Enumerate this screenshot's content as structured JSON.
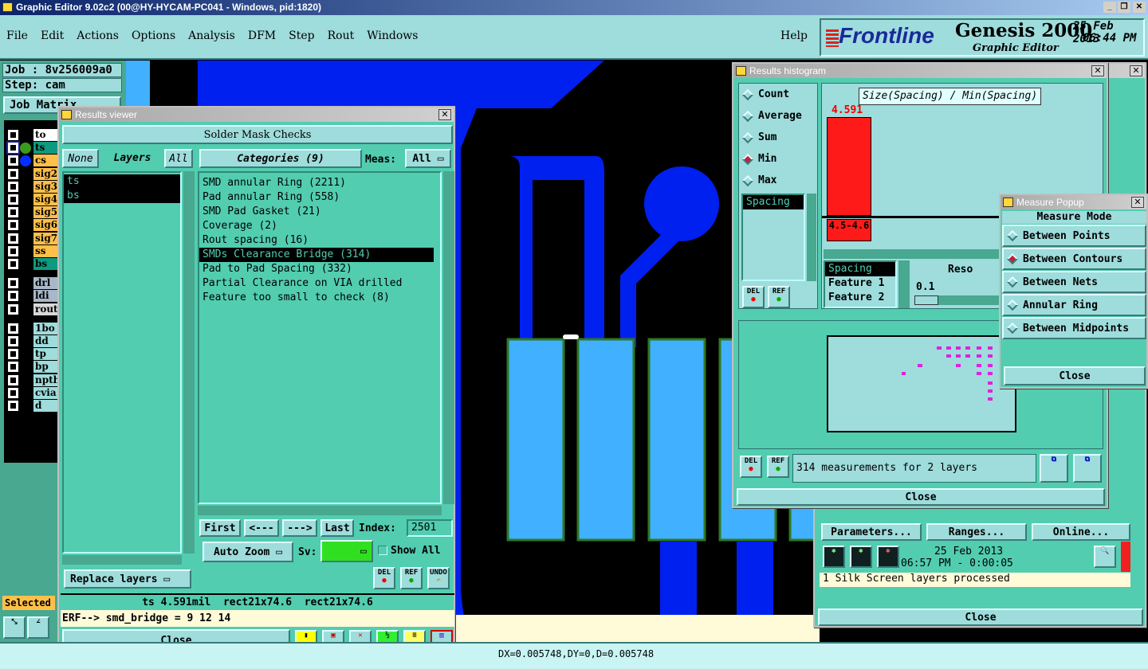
{
  "app": {
    "title": "Graphic Editor 9.02c2 (00@HY-HYCAM-PC041 - Windows, pid:1820)"
  },
  "menu": [
    "File",
    "Edit",
    "Actions",
    "Options",
    "Analysis",
    "DFM",
    "Step",
    "Rout",
    "Windows"
  ],
  "help": "Help",
  "logo": {
    "brand": "Frontline",
    "product": "Genesis 2000",
    "subtitle": "Graphic Editor",
    "date": "25 Feb 2013",
    "time": "06:44 PM"
  },
  "left": {
    "job": "Job : 8v256009a0",
    "step": "Step: cam",
    "job_matrix": "Job Matrix",
    "selected": "Selected",
    "layers": [
      {
        "name": "to",
        "color": "#ffffff"
      },
      {
        "name": "ts",
        "color": "#0e9a7e",
        "dot": "#3a9a20"
      },
      {
        "name": "cs",
        "color": "#ffc04a",
        "dot": "#0030ff"
      },
      {
        "name": "sig2",
        "color": "#ffc04a"
      },
      {
        "name": "sig3",
        "color": "#ffc04a"
      },
      {
        "name": "sig4",
        "color": "#ffc04a"
      },
      {
        "name": "sig5",
        "color": "#ffc04a"
      },
      {
        "name": "sig6",
        "color": "#ffc04a"
      },
      {
        "name": "sig7",
        "color": "#ffc04a"
      },
      {
        "name": "ss",
        "color": "#ffc04a"
      },
      {
        "name": "bs",
        "color": "#0e9a7e"
      },
      {
        "name": "drl",
        "color": "#a8b8c8"
      },
      {
        "name": "ldi",
        "color": "#a8b8c8"
      },
      {
        "name": "rout",
        "color": "#d8d8d8"
      },
      {
        "name": "1bo",
        "color": "#9fdcdc"
      },
      {
        "name": "dd",
        "color": "#9fdcdc"
      },
      {
        "name": "tp",
        "color": "#9fdcdc"
      },
      {
        "name": "bp",
        "color": "#9fdcdc"
      },
      {
        "name": "npth",
        "color": "#9fdcdc"
      },
      {
        "name": "cvia",
        "color": "#9fdcdc"
      },
      {
        "name": "d",
        "color": "#9fdcdc"
      }
    ]
  },
  "results_viewer": {
    "title": "Results viewer",
    "header": "Solder Mask Checks",
    "none": "None",
    "layers_label": "Layers",
    "all": "All",
    "layers": [
      "ts",
      "bs"
    ],
    "categories_label": "Categories (9)",
    "meas_label": "Meas:",
    "meas_value": "All",
    "categories": [
      "SMD annular Ring (2211)",
      "Pad annular Ring (558)",
      "SMD Pad Gasket (21)",
      "Coverage (2)",
      "Rout spacing (16)",
      "SMDs Clearance Bridge (314)",
      "Pad to Pad Spacing (332)",
      "Partial Clearance on VIA drilled",
      "Feature too small to check (8)"
    ],
    "selected_category": 5,
    "first": "First",
    "prev": "<---",
    "next": "--->",
    "last": "Last",
    "index_label": "Index:",
    "index_value": "2501",
    "auto_zoom": "Auto Zoom",
    "sv_label": "Sv:",
    "sv_color": "#30e020",
    "show_all": "Show All",
    "replace_layers": "Replace layers",
    "del": "DEL",
    "ref": "REF",
    "undo": "UNDO",
    "info": "ts 4.591mil  rect21x74.6  rect21x74.6",
    "erf": "ERF--> smd_bridge = 9 12 14",
    "close": "Close"
  },
  "histogram": {
    "title": "Results histogram",
    "modes": [
      "Count",
      "Average",
      "Sum",
      "Min",
      "Max"
    ],
    "selected_mode": 3,
    "attr_list": [
      "Spacing"
    ],
    "chart_title": "Size(Spacing) / Min(Spacing)",
    "bar_value": "4.591",
    "bar_range": "4.5-4.6",
    "bar_color": "#ff1a1a",
    "fields": [
      "Spacing",
      "Feature 1",
      "Feature 2"
    ],
    "resolution_label": "Reso",
    "resolution_value": "0.1",
    "del": "DEL",
    "ref": "REF",
    "summary": "314 measurements for 2 layers",
    "close": "Close"
  },
  "measure_popup": {
    "title": "Measure Popup",
    "header": "Measure Mode",
    "modes": [
      "Between Points",
      "Between Contours",
      "Between Nets",
      "Annular Ring",
      "Between Midpoints"
    ],
    "selected_mode": 1,
    "close": "Close"
  },
  "back_window": {
    "parameters": "Parameters...",
    "ranges": "Ranges...",
    "online": "Online...",
    "date": "25 Feb 2013",
    "time": "06:57 PM - 0:00:05",
    "status": "1 Silk Screen layers processed",
    "close": "Close"
  },
  "statusbar": {
    "text": "DX=0.005748,DY=0,D=0.005748"
  }
}
